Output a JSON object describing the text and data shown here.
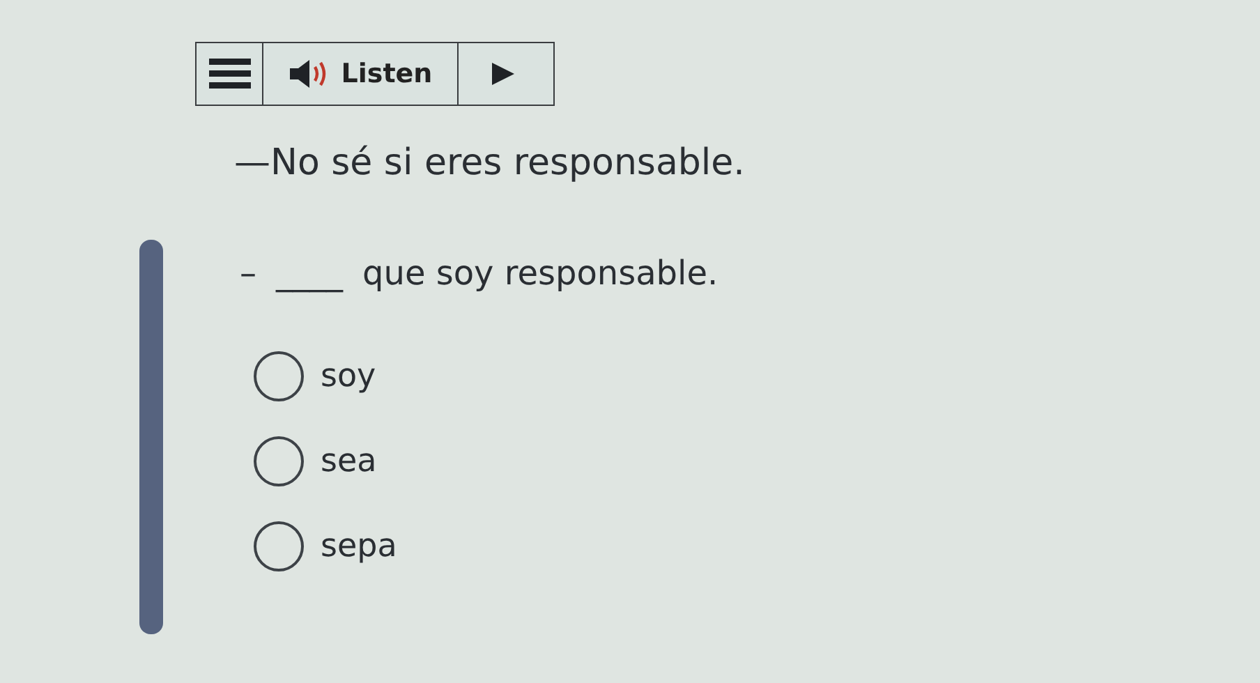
{
  "player": {
    "label": "Listen"
  },
  "prompt": "—No sé si eres responsable.",
  "question": {
    "dash": "–",
    "blank": "____",
    "text": "que soy responsable."
  },
  "options": [
    {
      "label": "soy",
      "selected": false
    },
    {
      "label": "sea",
      "selected": false
    },
    {
      "label": "sepa",
      "selected": false
    }
  ]
}
